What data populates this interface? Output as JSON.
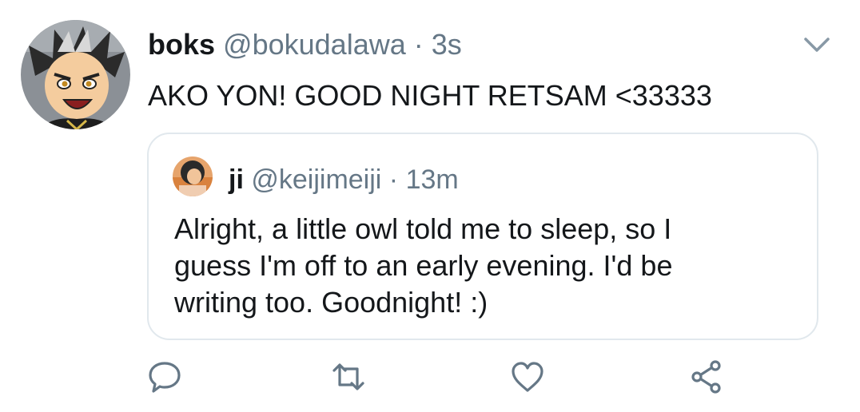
{
  "tweet": {
    "display_name": "boks",
    "handle": "@bokudalawa",
    "separator": "·",
    "time": "3s",
    "text": "AKO YON! GOOD NIGHT RETSAM <33333"
  },
  "quoted_tweet": {
    "display_name": "ji",
    "handle": "@keijimeiji",
    "separator": "·",
    "time": "13m",
    "text_lines": [
      "Alright, a little owl told me to sleep, so I",
      "guess I'm off to an early evening. I'd be",
      "writing too. Goodnight! :)"
    ]
  },
  "actions": [
    "reply-icon",
    "retweet-icon",
    "like-icon",
    "share-icon"
  ],
  "colors": {
    "text": "#14171a",
    "secondary": "#657786",
    "border": "#e1e8ed"
  }
}
